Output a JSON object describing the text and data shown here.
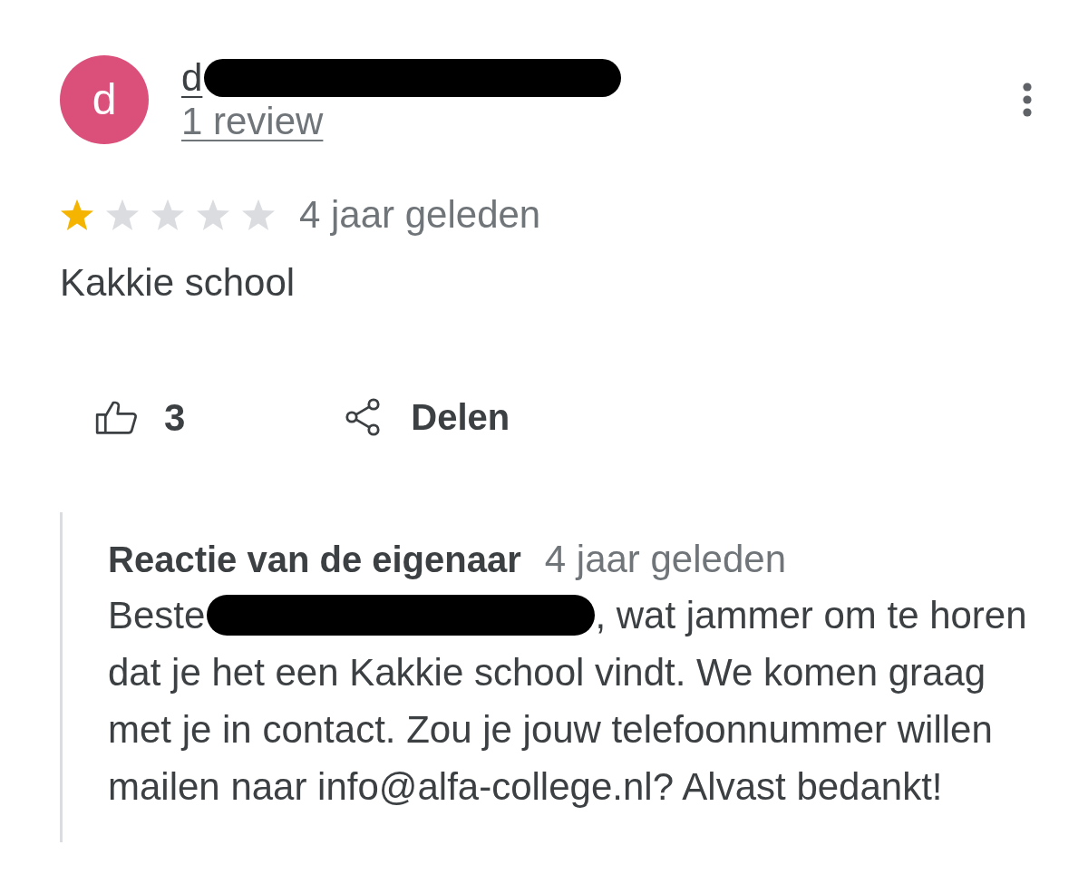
{
  "review": {
    "author": {
      "initial": "d",
      "name": "d",
      "name_redacted": true,
      "review_count": "1 review"
    },
    "stars": 1,
    "time": "4 jaar geleden",
    "text": "Kakkie school"
  },
  "actions": {
    "like_count": "3",
    "share_label": "Delen"
  },
  "owner_reply": {
    "title": "Reactie van de eigenaar",
    "time": "4 jaar geleden",
    "salutation": "Beste",
    "name_redacted": true,
    "text_start": ", wat jammer om te horen",
    "text_rest": "dat je het een Kakkie school vindt. We komen graag met je in contact. Zou je jouw telefoonnummer willen mailen naar info@alfa-college.nl? Alvast bedankt!"
  }
}
